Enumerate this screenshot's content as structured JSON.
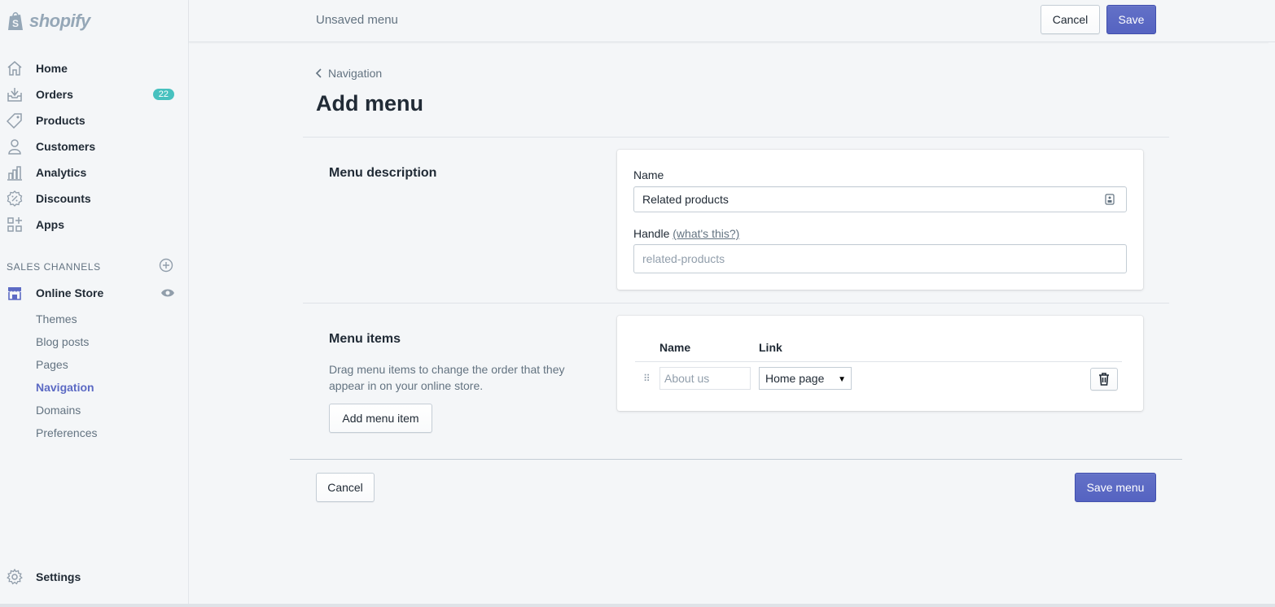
{
  "brand": {
    "name": "shopify"
  },
  "sidebar": {
    "items": [
      {
        "label": "Home",
        "icon": "home-icon"
      },
      {
        "label": "Orders",
        "icon": "orders-icon",
        "badge": "22"
      },
      {
        "label": "Products",
        "icon": "tag-icon"
      },
      {
        "label": "Customers",
        "icon": "person-icon"
      },
      {
        "label": "Analytics",
        "icon": "bar-chart-icon"
      },
      {
        "label": "Discounts",
        "icon": "discount-icon"
      },
      {
        "label": "Apps",
        "icon": "apps-icon"
      }
    ],
    "sales_channels_title": "SALES CHANNELS",
    "online_store": {
      "label": "Online Store",
      "sub_items": [
        "Themes",
        "Blog posts",
        "Pages",
        "Navigation",
        "Domains",
        "Preferences"
      ],
      "active_sub": "Navigation"
    },
    "settings_label": "Settings"
  },
  "topbar": {
    "title": "Unsaved menu",
    "cancel_label": "Cancel",
    "save_label": "Save"
  },
  "main": {
    "breadcrumb": "Navigation",
    "page_title": "Add menu",
    "menu_description": {
      "title": "Menu description",
      "name_label": "Name",
      "name_value": "Related products",
      "handle_label": "Handle",
      "handle_link": "(what's this?)",
      "handle_placeholder": "related-products"
    },
    "menu_items": {
      "title": "Menu items",
      "description": "Drag menu items to change the order that they appear in on your online store.",
      "add_button": "Add menu item",
      "col_name": "Name",
      "col_link": "Link",
      "rows": [
        {
          "name_placeholder": "About us",
          "link": "Home page"
        }
      ]
    },
    "footer": {
      "cancel_label": "Cancel",
      "save_label": "Save menu"
    }
  },
  "colors": {
    "primary": "#5c6ac4",
    "badge": "#47c1bf",
    "text": "#212b36",
    "subdued": "#637381"
  }
}
